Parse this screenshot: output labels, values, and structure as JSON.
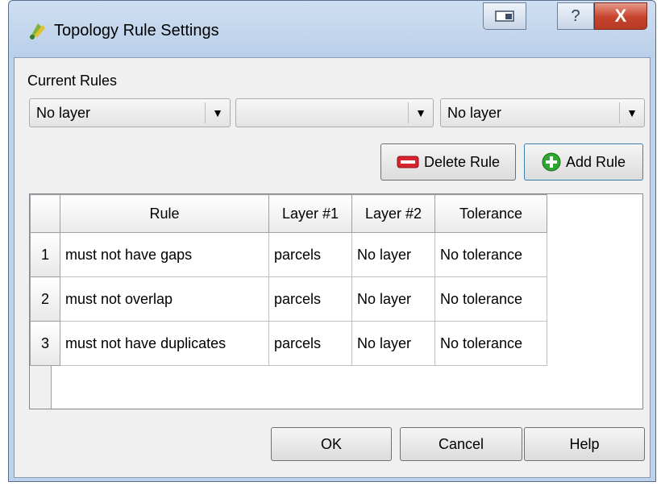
{
  "window": {
    "title": "Topology Rule Settings",
    "close_glyph": "X",
    "help_glyph": "?"
  },
  "current_rules_label": "Current Rules",
  "selectors": [
    {
      "value": "No layer"
    },
    {
      "value": ""
    },
    {
      "value": "No layer"
    }
  ],
  "buttons": {
    "delete_rule": "Delete Rule",
    "add_rule": "Add Rule",
    "ok": "OK",
    "cancel": "Cancel",
    "help": "Help"
  },
  "table": {
    "headers": [
      "Rule",
      "Layer #1",
      "Layer #2",
      "Tolerance"
    ],
    "rows": [
      {
        "num": "1",
        "rule": "must not have gaps",
        "layer1": "parcels",
        "layer2": "No layer",
        "tolerance": "No tolerance"
      },
      {
        "num": "2",
        "rule": "must not overlap",
        "layer1": "parcels",
        "layer2": "No layer",
        "tolerance": "No tolerance"
      },
      {
        "num": "3",
        "rule": "must not have duplicates",
        "layer1": "parcels",
        "layer2": "No layer",
        "tolerance": "No tolerance"
      }
    ]
  },
  "icons": {
    "app": "qgis-topology-icon",
    "delete": "minus-icon",
    "add": "plus-icon"
  },
  "colors": {
    "delete_icon": "#d9232e",
    "add_icon": "#2fa82f",
    "close_button": "#c8432c"
  }
}
